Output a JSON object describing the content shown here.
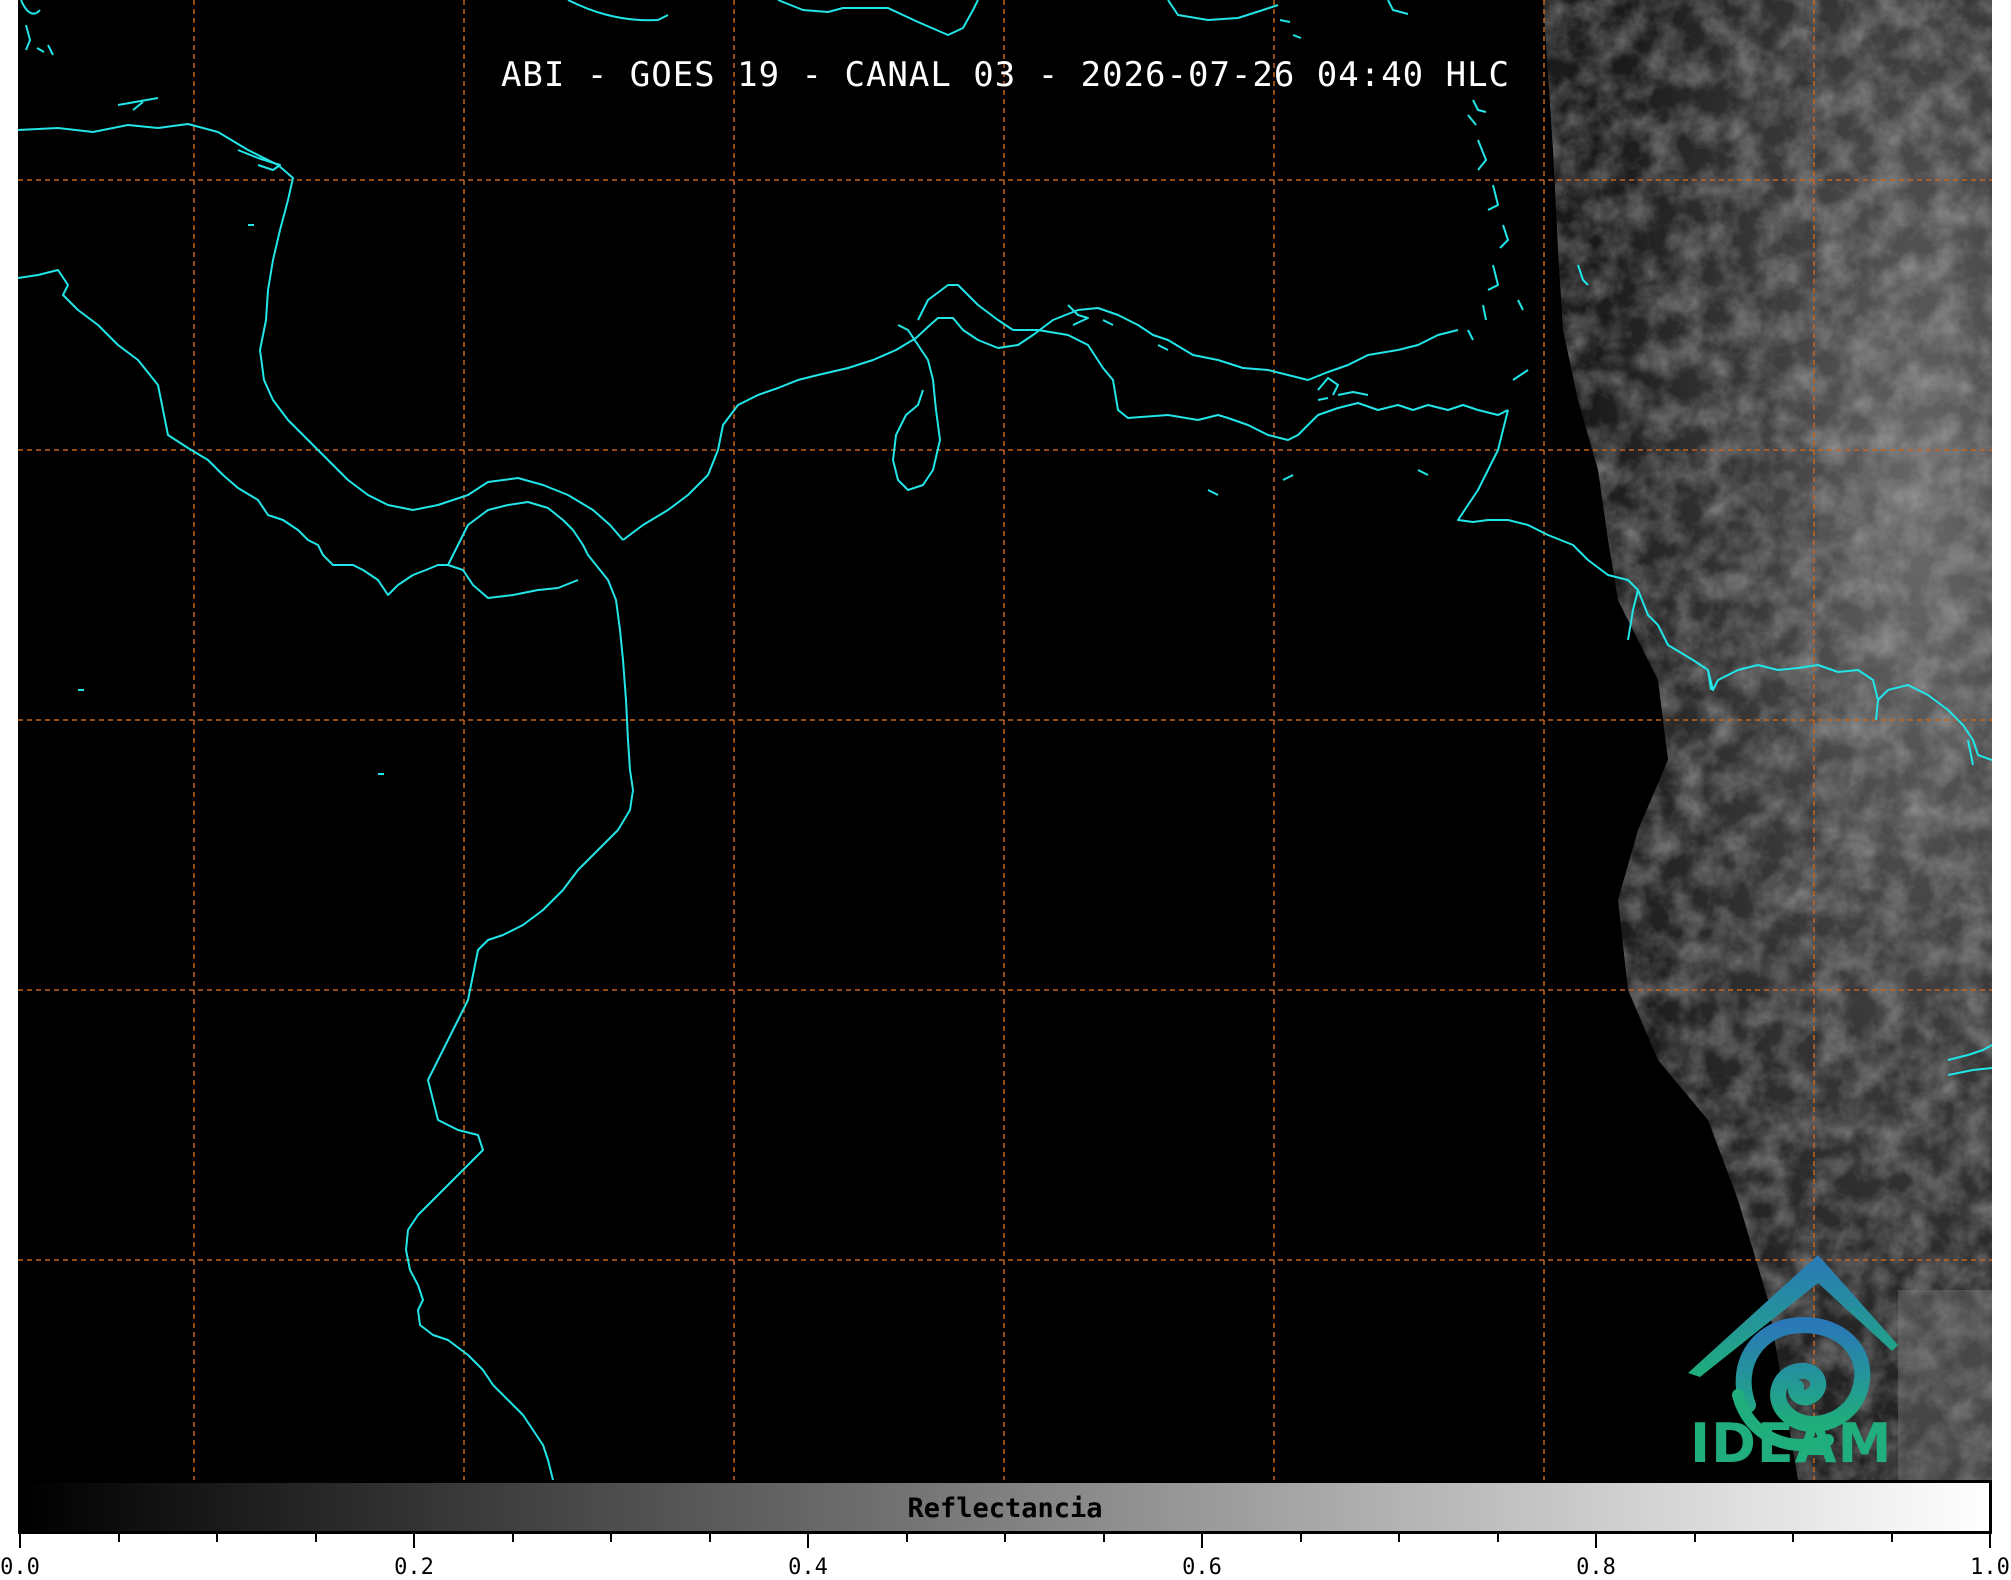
{
  "title": "ABI - GOES 19 - CANAL 03 - 2026-07-26 04:40 HLC",
  "colorbar": {
    "label": "Reflectancia",
    "min": 0.0,
    "max": 1.0,
    "tick_labels": [
      "0.0",
      "0.2",
      "0.4",
      "0.6",
      "0.8",
      "1.0"
    ],
    "minor_tick_step": 0.05,
    "colormap": [
      "#000000",
      "#ffffff"
    ]
  },
  "logo": {
    "text": "IDEAM",
    "color_top": "#2a78b8",
    "color_bottom": "#1fae7c"
  },
  "colors": {
    "coastline": "#22e5e8",
    "grid": "#c8641e",
    "background": "#000000"
  }
}
